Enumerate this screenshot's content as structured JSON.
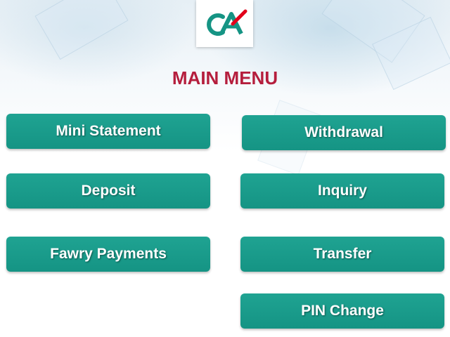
{
  "header": {
    "logo": {
      "icon": "credit-agricole-logo-icon",
      "colors": [
        "#159484",
        "#e2001a"
      ]
    },
    "title": "MAIN MENU"
  },
  "menu": {
    "left": [
      {
        "id": "mini-statement",
        "label": "Mini Statement"
      },
      {
        "id": "deposit",
        "label": "Deposit"
      },
      {
        "id": "fawry-payments",
        "label": "Fawry Payments"
      }
    ],
    "right": [
      {
        "id": "withdrawal",
        "label": "Withdrawal"
      },
      {
        "id": "inquiry",
        "label": "Inquiry"
      },
      {
        "id": "transfer",
        "label": "Transfer"
      },
      {
        "id": "pin-change",
        "label": "PIN Change"
      }
    ]
  },
  "colors": {
    "button": "#1a9a8a",
    "title": "#b51e3d",
    "button_text": "#ffffff"
  }
}
